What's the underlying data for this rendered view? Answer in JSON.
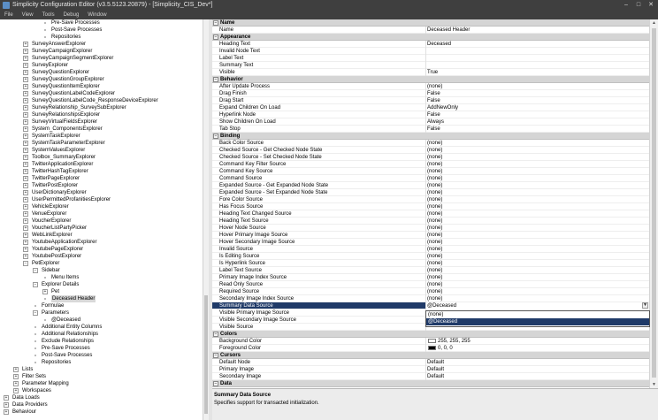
{
  "window": {
    "title": "Simplicity Configuration Editor (v3.5.5123.20879) - [Simplicity_CIS_Dev*]",
    "minimize": "–",
    "maximize": "□",
    "close": "✕"
  },
  "menu": [
    "File",
    "View",
    "Tools",
    "Debug",
    "Window"
  ],
  "tree": [
    {
      "label": "Pre-Save Processes",
      "level": 5,
      "exp": null
    },
    {
      "label": "Post-Save Processes",
      "level": 5,
      "exp": null
    },
    {
      "label": "Repositories",
      "level": 5,
      "exp": null
    },
    {
      "label": "SurveyAnswerExplorer",
      "level": 3,
      "exp": "+"
    },
    {
      "label": "SurveyCampaignExplorer",
      "level": 3,
      "exp": "+"
    },
    {
      "label": "SurveyCampaignSegmentExplorer",
      "level": 3,
      "exp": "+"
    },
    {
      "label": "SurveyExplorer",
      "level": 3,
      "exp": "+"
    },
    {
      "label": "SurveyQuestionExplorer",
      "level": 3,
      "exp": "+"
    },
    {
      "label": "SurveyQuestionGroupExplorer",
      "level": 3,
      "exp": "+"
    },
    {
      "label": "SurveyQuestionItemExplorer",
      "level": 3,
      "exp": "+"
    },
    {
      "label": "SurveyQuestionLabelCodeExplorer",
      "level": 3,
      "exp": "+"
    },
    {
      "label": "SurveyQuestionLabelCode_ResponseDeviceExplorer",
      "level": 3,
      "exp": "+"
    },
    {
      "label": "SurveyRelationship_SurveySubExplorer",
      "level": 3,
      "exp": "+"
    },
    {
      "label": "SurveyRelationshipsExplorer",
      "level": 3,
      "exp": "+"
    },
    {
      "label": "SurveyVirtualFieldsExplorer",
      "level": 3,
      "exp": "+"
    },
    {
      "label": "System_ComponentsExplorer",
      "level": 3,
      "exp": "+"
    },
    {
      "label": "SystemTaskExplorer",
      "level": 3,
      "exp": "+"
    },
    {
      "label": "SystemTaskParameterExplorer",
      "level": 3,
      "exp": "+"
    },
    {
      "label": "SystemValuesExplorer",
      "level": 3,
      "exp": "+"
    },
    {
      "label": "Toolbox_SummaryExplorer",
      "level": 3,
      "exp": "+"
    },
    {
      "label": "TwitterApplicationExplorer",
      "level": 3,
      "exp": "+"
    },
    {
      "label": "TwitterHashTagExplorer",
      "level": 3,
      "exp": "+"
    },
    {
      "label": "TwitterPageExplorer",
      "level": 3,
      "exp": "+"
    },
    {
      "label": "TwitterPostExplorer",
      "level": 3,
      "exp": "+"
    },
    {
      "label": "UserDictionaryExplorer",
      "level": 3,
      "exp": "+"
    },
    {
      "label": "UserPermittedProfanitiesExplorer",
      "level": 3,
      "exp": "+"
    },
    {
      "label": "VehicleExplorer",
      "level": 3,
      "exp": "+"
    },
    {
      "label": "VenueExplorer",
      "level": 3,
      "exp": "+"
    },
    {
      "label": "VoucherExplorer",
      "level": 3,
      "exp": "+"
    },
    {
      "label": "VoucherListPartyPicker",
      "level": 3,
      "exp": "+"
    },
    {
      "label": "WebLinkExplorer",
      "level": 3,
      "exp": "+"
    },
    {
      "label": "YoutubeApplicationExplorer",
      "level": 3,
      "exp": "+"
    },
    {
      "label": "YoutubePageExplorer",
      "level": 3,
      "exp": "+"
    },
    {
      "label": "YoutubePostExplorer",
      "level": 3,
      "exp": "+"
    },
    {
      "label": "PetExplorer",
      "level": 3,
      "exp": "−"
    },
    {
      "label": "Sidebar",
      "level": 4,
      "exp": "−"
    },
    {
      "label": "Menu Items",
      "level": 5,
      "exp": null
    },
    {
      "label": "Explorer Details",
      "level": 4,
      "exp": "−"
    },
    {
      "label": "Pet",
      "level": 5,
      "exp": "+"
    },
    {
      "label": "Deceased Header",
      "level": 5,
      "exp": null,
      "selected": true
    },
    {
      "label": "Formulae",
      "level": 4,
      "exp": null
    },
    {
      "label": "Parameters",
      "level": 4,
      "exp": "−"
    },
    {
      "label": "@Deceased",
      "level": 5,
      "exp": null
    },
    {
      "label": "Additional Entity Columns",
      "level": 4,
      "exp": null
    },
    {
      "label": "Additional Relationships",
      "level": 4,
      "exp": null
    },
    {
      "label": "Exclude Relationships",
      "level": 4,
      "exp": null
    },
    {
      "label": "Pre-Save Processes",
      "level": 4,
      "exp": null
    },
    {
      "label": "Post-Save Processes",
      "level": 4,
      "exp": null
    },
    {
      "label": "Repositories",
      "level": 4,
      "exp": null
    },
    {
      "label": "Lists",
      "level": 2,
      "exp": "+"
    },
    {
      "label": "Filter Sets",
      "level": 2,
      "exp": "+"
    },
    {
      "label": "Parameter Mapping",
      "level": 2,
      "exp": "+"
    },
    {
      "label": "Workspaces",
      "level": 2,
      "exp": "+"
    },
    {
      "label": "Data Loads",
      "level": 1,
      "exp": "+"
    },
    {
      "label": "Data Providers",
      "level": 1,
      "exp": "+"
    },
    {
      "label": "Behaviour",
      "level": 1,
      "exp": "+"
    }
  ],
  "props": [
    {
      "cat": "Name"
    },
    {
      "name": "Name",
      "value": "Deceased Header"
    },
    {
      "cat": "Appearance"
    },
    {
      "name": "Heading Text",
      "value": "Deceased"
    },
    {
      "name": "Invalid Node Text",
      "value": ""
    },
    {
      "name": "Label Text",
      "value": ""
    },
    {
      "name": "Summary Text",
      "value": ""
    },
    {
      "name": "Visible",
      "value": "True"
    },
    {
      "cat": "Behavior"
    },
    {
      "name": "After Update Process",
      "value": "(none)"
    },
    {
      "name": "Drag Finish",
      "value": "False"
    },
    {
      "name": "Drag Start",
      "value": "False"
    },
    {
      "name": "Expand Children On Load",
      "value": "AddNewOnly"
    },
    {
      "name": "Hyperlink Node",
      "value": "False"
    },
    {
      "name": "Show Children On Load",
      "value": "Always"
    },
    {
      "name": "Tab Stop",
      "value": "False"
    },
    {
      "cat": "Binding"
    },
    {
      "name": "Back Color Source",
      "value": "(none)"
    },
    {
      "name": "Checked Source - Get Checked Node State",
      "value": "(none)"
    },
    {
      "name": "Checked Source - Set Checked Node State",
      "value": "(none)"
    },
    {
      "name": "Command Key Filter Source",
      "value": "(none)"
    },
    {
      "name": "Command Key Source",
      "value": "(none)"
    },
    {
      "name": "Command Source",
      "value": "(none)"
    },
    {
      "name": "Expanded Source - Get Expanded Node State",
      "value": "(none)"
    },
    {
      "name": "Expanded Source - Set Expanded Node State",
      "value": "(none)"
    },
    {
      "name": "Fore Color Source",
      "value": "(none)"
    },
    {
      "name": "Has Focus Source",
      "value": "(none)"
    },
    {
      "name": "Heading Text Changed Source",
      "value": "(none)"
    },
    {
      "name": "Heading Text Source",
      "value": "(none)"
    },
    {
      "name": "Hover Node Source",
      "value": "(none)"
    },
    {
      "name": "Hover Primary Image Source",
      "value": "(none)"
    },
    {
      "name": "Hover Secondary Image Source",
      "value": "(none)"
    },
    {
      "name": "Invalid Source",
      "value": "(none)"
    },
    {
      "name": "Is Editing Source",
      "value": "(none)"
    },
    {
      "name": "Is Hyperlink Source",
      "value": "(none)"
    },
    {
      "name": "Label Text Source",
      "value": "(none)"
    },
    {
      "name": "Primary Image Index Source",
      "value": "(none)"
    },
    {
      "name": "Read Only Source",
      "value": "(none)"
    },
    {
      "name": "Required Source",
      "value": "(none)"
    },
    {
      "name": "Secondary Image Index Source",
      "value": "(none)"
    },
    {
      "name": "Summary Data Source",
      "value": "@Deceased",
      "selected": true,
      "dropdown": true
    },
    {
      "name": "Visible Primary Image Source",
      "value": ""
    },
    {
      "name": "Visible Secondary Image Source",
      "value": ""
    },
    {
      "name": "Visible Source",
      "value": ""
    },
    {
      "cat": "Colors"
    },
    {
      "name": "Background Color",
      "value": "255, 255, 255",
      "swatch": "#ffffff"
    },
    {
      "name": "Foreground Color",
      "value": "0, 0, 0",
      "swatch": "#000000"
    },
    {
      "cat": "Cursors"
    },
    {
      "name": "Default Node",
      "value": "Default"
    },
    {
      "name": "Primary Image",
      "value": "Default"
    },
    {
      "name": "Secondary Image",
      "value": "Default"
    },
    {
      "cat": "Data"
    }
  ],
  "dropdown": {
    "options": [
      "(none)",
      "@Deceased"
    ],
    "highlighted": 1
  },
  "description": {
    "title": "Summary Data Source",
    "text": "Specifies support for transacted initialization."
  },
  "colors": {
    "titlebar": "#3f3f3f",
    "selection": "#1f3a68",
    "category": "#d5d5d5"
  }
}
